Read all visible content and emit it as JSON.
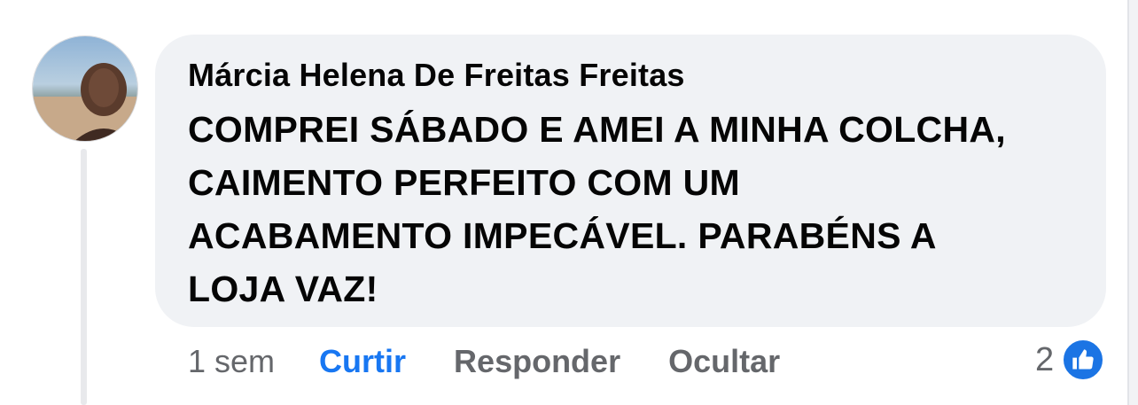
{
  "comment": {
    "author": "Márcia Helena De Freitas Freitas",
    "text": "COMPREI SÁBADO E AMEI A MINHA COLCHA,\nCAIMENTO PERFEITO COM UM\nACABAMENTO IMPECÁVEL.  PARABÉNS A\nLOJA VAZ!",
    "avatar_icon": "profile-photo"
  },
  "actions": {
    "timestamp": "1 sem",
    "like_label": "Curtir",
    "reply_label": "Responder",
    "hide_label": "Ocultar"
  },
  "reactions": {
    "count": "2",
    "icon": "thumbs-up-icon"
  },
  "colors": {
    "bubble": "#f0f2f5",
    "like_blue": "#1877f2",
    "muted_text": "#65676b",
    "text": "#050505"
  }
}
